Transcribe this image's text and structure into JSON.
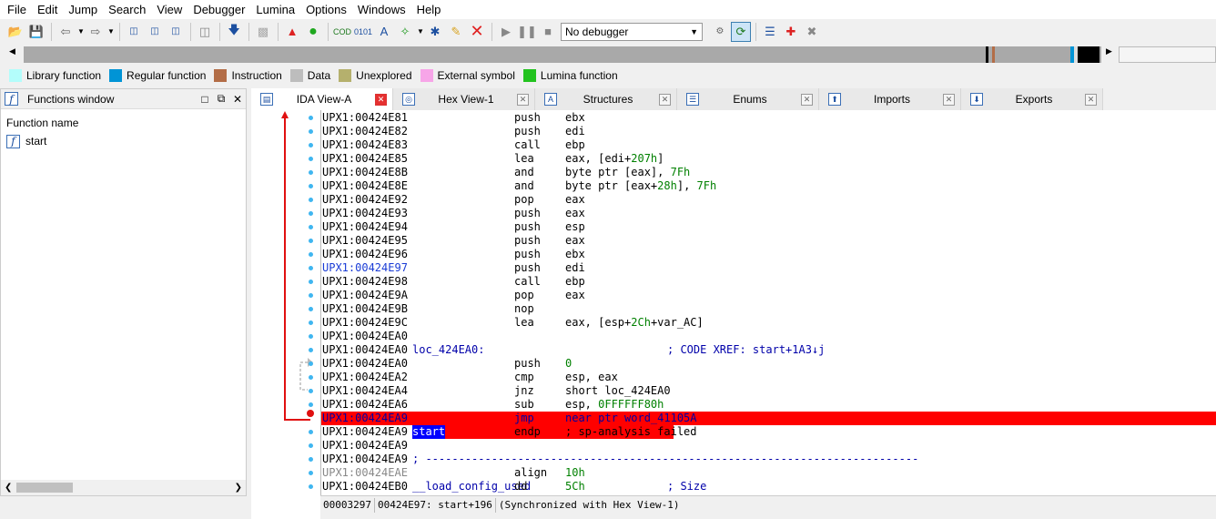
{
  "menu": [
    "File",
    "Edit",
    "Jump",
    "Search",
    "View",
    "Debugger",
    "Lumina",
    "Options",
    "Windows",
    "Help"
  ],
  "toolbar": {
    "debugger_select": "No debugger",
    "icons": [
      "open-file-icon",
      "save-icon",
      "back-icon",
      "forward-icon",
      "search-binary-icon",
      "search-text-icon",
      "search-imm-icon",
      "search-next-icon",
      "jump-down-icon",
      "disabled-icon",
      "warning-icon",
      "green-circle-icon",
      "code-icon",
      "data-icon",
      "ascii-icon",
      "struct-icon",
      "xref-icon",
      "patch-icon",
      "delete-icon",
      "play-icon",
      "pause-icon",
      "stop-icon",
      "sync-icon",
      "refresh-icon",
      "list-icon",
      "add-breakpoint-icon",
      "settings-icon"
    ]
  },
  "legend": [
    {
      "label": "Library function",
      "color": "#b3fdfb"
    },
    {
      "label": "Regular function",
      "color": "#0094d6"
    },
    {
      "label": "Instruction",
      "color": "#b36d47"
    },
    {
      "label": "Data",
      "color": "#bdbdbd"
    },
    {
      "label": "Unexplored",
      "color": "#b5b06d"
    },
    {
      "label": "External symbol",
      "color": "#f7a5e8"
    },
    {
      "label": "Lumina function",
      "color": "#23c31f"
    }
  ],
  "functions_window": {
    "title": "Functions window",
    "column_header": "Function name",
    "items": [
      "start"
    ]
  },
  "tabs": [
    {
      "label": "IDA View-A",
      "active": true
    },
    {
      "label": "Hex View-1",
      "active": false
    },
    {
      "label": "Structures",
      "active": false
    },
    {
      "label": "Enums",
      "active": false
    },
    {
      "label": "Imports",
      "active": false
    },
    {
      "label": "Exports",
      "active": false
    }
  ],
  "listing": [
    {
      "addr": "UPX1:00424E81",
      "mnem": "push",
      "ops": "ebx"
    },
    {
      "addr": "UPX1:00424E82",
      "mnem": "push",
      "ops": "edi"
    },
    {
      "addr": "UPX1:00424E83",
      "mnem": "call",
      "ops": "ebp"
    },
    {
      "addr": "UPX1:00424E85",
      "mnem": "lea",
      "ops": "eax, [edi+",
      "num": "207h",
      "ops_tail": "]"
    },
    {
      "addr": "UPX1:00424E8B",
      "mnem": "and",
      "ops": "byte ptr [eax], ",
      "num": "7Fh"
    },
    {
      "addr": "UPX1:00424E8E",
      "mnem": "and",
      "ops": "byte ptr [eax+",
      "num": "28h",
      "ops_tail": "], ",
      "num2": "7Fh"
    },
    {
      "addr": "UPX1:00424E92",
      "mnem": "pop",
      "ops": "eax"
    },
    {
      "addr": "UPX1:00424E93",
      "mnem": "push",
      "ops": "eax"
    },
    {
      "addr": "UPX1:00424E94",
      "mnem": "push",
      "ops": "esp"
    },
    {
      "addr": "UPX1:00424E95",
      "mnem": "push",
      "ops": "eax"
    },
    {
      "addr": "UPX1:00424E96",
      "mnem": "push",
      "ops": "ebx"
    },
    {
      "addr": "UPX1:00424E97",
      "mnem": "push",
      "ops": "edi",
      "addr_style": "blue"
    },
    {
      "addr": "UPX1:00424E98",
      "mnem": "call",
      "ops": "ebp"
    },
    {
      "addr": "UPX1:00424E9A",
      "mnem": "pop",
      "ops": "eax"
    },
    {
      "addr": "UPX1:00424E9B",
      "mnem": "nop",
      "ops": ""
    },
    {
      "addr": "UPX1:00424E9C",
      "mnem": "lea",
      "ops": "eax, [esp+",
      "num": "2Ch",
      "ops_tail": "+var_AC]"
    },
    {
      "addr": "UPX1:00424EA0",
      "mnem": "",
      "ops": ""
    },
    {
      "addr": "UPX1:00424EA0",
      "label": "loc_424EA0:",
      "comment": "; CODE XREF: start+1A3↓j"
    },
    {
      "addr": "UPX1:00424EA0",
      "mnem": "push",
      "ops": "",
      "num": "0"
    },
    {
      "addr": "UPX1:00424EA2",
      "mnem": "cmp",
      "ops": "esp, eax"
    },
    {
      "addr": "UPX1:00424EA4",
      "mnem": "jnz",
      "ops": "short loc_424EA0"
    },
    {
      "addr": "UPX1:00424EA6",
      "mnem": "sub",
      "ops": "esp, ",
      "num": "0FFFFFF80h"
    },
    {
      "addr": "UPX1:00424EA9",
      "mnem": "jmp",
      "ops": "near ptr word_41105A",
      "highlight": true
    },
    {
      "addr": "UPX1:00424EA9",
      "label": "start",
      "mnem": "endp",
      "ops": "; sp-analysis failed",
      "highlight_partial": true
    },
    {
      "addr": "UPX1:00424EA9",
      "mnem": "",
      "ops": ""
    },
    {
      "addr": "UPX1:00424EA9",
      "comment": "; ---------------------------------------------------------------------------"
    },
    {
      "addr": "UPX1:00424EAE",
      "mnem": "align",
      "ops": "",
      "num": "10h",
      "addr_style": "grey"
    },
    {
      "addr": "UPX1:00424EB0",
      "label": "__load_config_used",
      "mnem": "dd",
      "num": "5Ch",
      "comment": "; Size"
    }
  ],
  "status": {
    "offset": "00003297",
    "location": "00424E97: start+196",
    "sync": "(Synchronized with Hex View-1)"
  }
}
